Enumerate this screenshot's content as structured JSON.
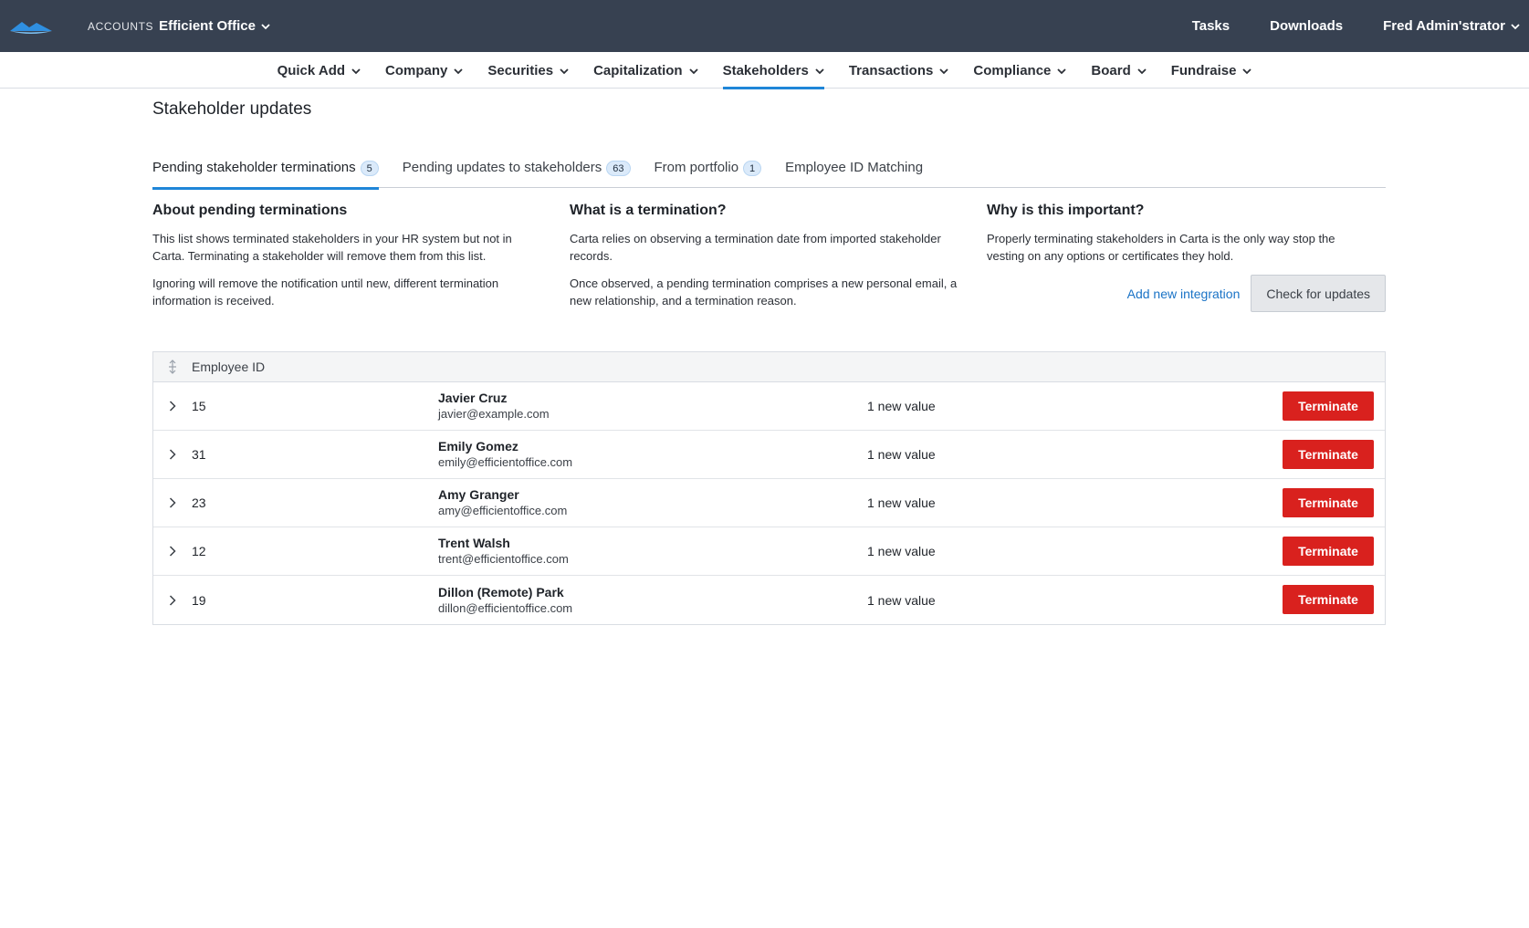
{
  "topbar": {
    "logo_icon": "carta-logo-icon",
    "accounts_label": "ACCOUNTS",
    "account_name": "Efficient Office",
    "tasks": "Tasks",
    "downloads": "Downloads",
    "user": "Fred Admin'strator",
    "background": "#374151"
  },
  "nav": {
    "items": [
      {
        "label": "Quick Add"
      },
      {
        "label": "Company"
      },
      {
        "label": "Securities"
      },
      {
        "label": "Capitalization"
      },
      {
        "label": "Stakeholders",
        "active": true
      },
      {
        "label": "Transactions"
      },
      {
        "label": "Compliance"
      },
      {
        "label": "Board"
      },
      {
        "label": "Fundraise"
      }
    ],
    "accent": "#1f86d8"
  },
  "page": {
    "title": "Stakeholder updates"
  },
  "tabs": [
    {
      "label": "Pending stakeholder terminations",
      "count": "5",
      "active": true
    },
    {
      "label": "Pending updates to stakeholders",
      "count": "63"
    },
    {
      "label": "From portfolio",
      "count": "1"
    },
    {
      "label": "Employee ID Matching",
      "count": null
    }
  ],
  "info": {
    "about": {
      "heading": "About pending terminations",
      "p1": "This list shows terminated stakeholders in your HR system but not in Carta. Terminating a stakeholder will remove them from this list.",
      "p2": "Ignoring will remove the notification until new, different termination information is received."
    },
    "what": {
      "heading": "What is a termination?",
      "p1": "Carta relies on observing a termination date from imported stakeholder records.",
      "p2": "Once observed, a pending termination comprises a new personal email, a new relationship, and a termination reason."
    },
    "why": {
      "heading": "Why is this important?",
      "p1": "Properly terminating stakeholders in Carta is the only way stop the vesting on any options or certificates they hold.",
      "add_integration": "Add new integration",
      "check_updates": "Check for updates"
    }
  },
  "table": {
    "header": "Employee ID",
    "terminate_label": "Terminate",
    "danger_color": "#d9211e",
    "rows": [
      {
        "id": "15",
        "name": "Javier Cruz",
        "email": "javier@example.com",
        "status": "1 new value"
      },
      {
        "id": "31",
        "name": "Emily Gomez",
        "email": "emily@efficientoffice.com",
        "status": "1 new value"
      },
      {
        "id": "23",
        "name": "Amy Granger",
        "email": "amy@efficientoffice.com",
        "status": "1 new value"
      },
      {
        "id": "12",
        "name": "Trent Walsh",
        "email": "trent@efficientoffice.com",
        "status": "1 new value"
      },
      {
        "id": "19",
        "name": "Dillon (Remote) Park",
        "email": "dillon@efficientoffice.com",
        "status": "1 new value"
      }
    ]
  }
}
